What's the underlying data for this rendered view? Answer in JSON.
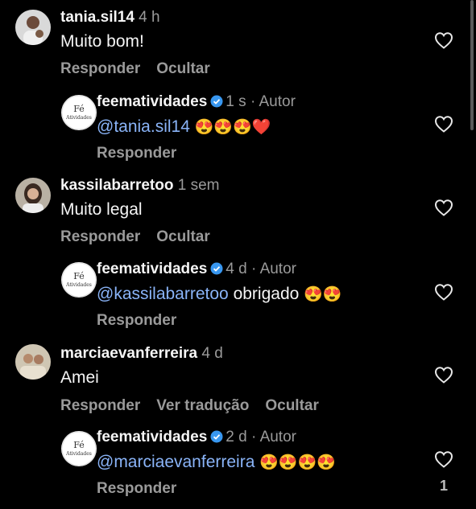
{
  "comments": [
    {
      "username": "tania.sil14",
      "time": "4 h",
      "text": "Muito bom!",
      "actions": [
        "Responder",
        "Ocultar"
      ],
      "reply": {
        "username": "feematividades",
        "time": "1 s",
        "author_label": "Autor",
        "separator": "·",
        "mention": "@tania.sil14",
        "text": "",
        "emojis": "😍😍😍❤️",
        "action": "Responder"
      }
    },
    {
      "username": "kassilabarretoo",
      "time": "1 sem",
      "text": "Muito legal",
      "actions": [
        "Responder",
        "Ocultar"
      ],
      "reply": {
        "username": "feematividades",
        "time": "4 d",
        "author_label": "Autor",
        "separator": "·",
        "mention": "@kassilabarretoo",
        "text": " obrigado ",
        "emojis": "😍😍",
        "action": "Responder"
      }
    },
    {
      "username": "marciaevanferreira",
      "time": "4 d",
      "text": "Amei",
      "actions": [
        "Responder",
        "Ver tradução",
        "Ocultar"
      ],
      "reply": {
        "username": "feematividades",
        "time": "2 d",
        "author_label": "Autor",
        "separator": "·",
        "mention": "@marciaevanferreira",
        "text": " ",
        "emojis": "😍😍😍😍",
        "action": "Responder",
        "like_count": "1"
      }
    }
  ],
  "brand_avatar_text": {
    "line1": "Fé",
    "line2": "Atividades"
  },
  "colors": {
    "background": "#000000",
    "mention": "#8ab4f8",
    "verified": "#3897f0",
    "muted": "#9a9a9a"
  },
  "icons": {
    "like": "heart-outline-icon",
    "verified": "verified-badge-icon"
  }
}
